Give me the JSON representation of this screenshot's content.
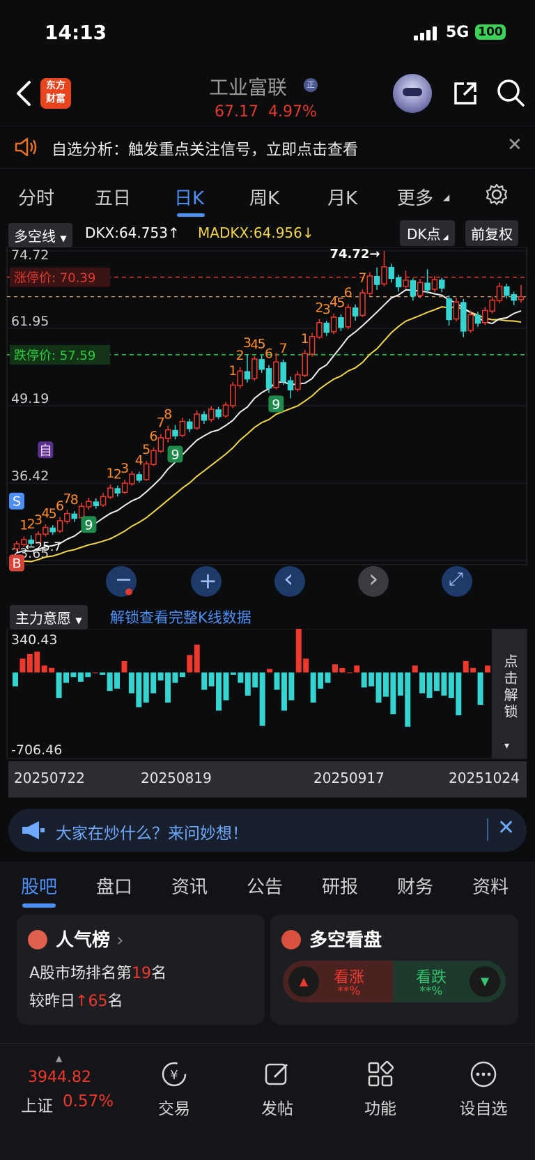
{
  "status_bar": {
    "time": "14:13",
    "network": "5G",
    "battery": "100"
  },
  "nav": {
    "logo_line1": "东方",
    "logo_line2": "财富",
    "stock_name": "工业富联",
    "reg_badge": "正",
    "price": "67.17",
    "change_pct": "4.97%"
  },
  "notice": {
    "text": "自选分析：触发重点关注信号，立即点击查看"
  },
  "chart_tabs": [
    "分时",
    "五日",
    "日K",
    "周K",
    "月K",
    "更多"
  ],
  "chart_header": {
    "indicator": "多空线",
    "dkx": "DKX:64.753",
    "dkx_arrow": "↑",
    "madkx": "MADKX:64.956",
    "madkx_arrow": "↓",
    "dk_button": "DK点",
    "adjust_button": "前复权"
  },
  "chart_data": {
    "type": "candlestick",
    "y_ticks": [
      "74.72",
      "61.95",
      "49.19",
      "36.42",
      "23.65"
    ],
    "limit_up_label": "涨停价: 70.39",
    "limit_down_label": "跌停价: 57.59",
    "limit_up": 70.39,
    "limit_down": 57.59,
    "max_annotation": "74.72",
    "min_annotation": "25.7",
    "ylim": [
      23.65,
      74.72
    ],
    "candles": [
      [
        25.6,
        26.4,
        25.2,
        26.9
      ],
      [
        26.3,
        27.1,
        25.9,
        27.6
      ],
      [
        27.0,
        26.5,
        26.0,
        27.8
      ],
      [
        26.6,
        28.0,
        26.3,
        28.5
      ],
      [
        28.0,
        29.1,
        27.6,
        29.6
      ],
      [
        29.0,
        28.4,
        27.9,
        29.5
      ],
      [
        28.5,
        30.2,
        28.2,
        30.8
      ],
      [
        30.1,
        31.4,
        29.7,
        32.0
      ],
      [
        31.3,
        30.6,
        30.0,
        31.8
      ],
      [
        30.7,
        32.6,
        30.4,
        33.2
      ],
      [
        32.5,
        33.4,
        32.0,
        34.0
      ],
      [
        33.3,
        32.7,
        32.2,
        33.9
      ],
      [
        32.8,
        34.2,
        32.5,
        34.8
      ],
      [
        34.1,
        35.6,
        33.8,
        36.2
      ],
      [
        35.5,
        34.8,
        34.2,
        36.0
      ],
      [
        34.9,
        36.4,
        34.6,
        37.0
      ],
      [
        36.3,
        37.9,
        36.0,
        38.4
      ],
      [
        37.8,
        36.9,
        36.5,
        38.3
      ],
      [
        37.0,
        39.6,
        36.8,
        40.1
      ],
      [
        39.5,
        41.8,
        39.2,
        42.3
      ],
      [
        41.7,
        43.9,
        41.4,
        44.5
      ],
      [
        43.8,
        45.2,
        43.1,
        45.9
      ],
      [
        45.1,
        44.2,
        43.6,
        46.0
      ],
      [
        44.3,
        46.6,
        44.0,
        47.2
      ],
      [
        46.5,
        45.4,
        44.8,
        47.0
      ],
      [
        45.5,
        47.8,
        45.2,
        48.4
      ],
      [
        47.7,
        46.8,
        46.2,
        48.3
      ],
      [
        46.9,
        48.6,
        46.5,
        49.1
      ],
      [
        48.5,
        47.4,
        47.0,
        49.0
      ],
      [
        47.5,
        49.3,
        47.2,
        49.8
      ],
      [
        49.2,
        52.6,
        48.8,
        53.1
      ],
      [
        52.5,
        54.9,
        52.0,
        55.6
      ],
      [
        54.8,
        53.6,
        53.0,
        57.7
      ],
      [
        53.7,
        56.9,
        53.3,
        57.4
      ],
      [
        56.8,
        55.2,
        54.6,
        57.5
      ],
      [
        55.3,
        52.1,
        51.3,
        55.9
      ],
      [
        52.2,
        56.4,
        51.9,
        57.9
      ],
      [
        56.3,
        53.2,
        52.6,
        56.8
      ],
      [
        53.3,
        51.8,
        50.4,
        54.0
      ],
      [
        51.9,
        54.3,
        51.5,
        54.9
      ],
      [
        54.2,
        57.8,
        53.9,
        58.4
      ],
      [
        57.7,
        60.6,
        57.3,
        61.2
      ],
      [
        60.5,
        62.9,
        60.2,
        63.5
      ],
      [
        62.8,
        61.3,
        60.7,
        63.2
      ],
      [
        61.4,
        63.8,
        61.0,
        64.4
      ],
      [
        63.7,
        62.1,
        61.5,
        64.3
      ],
      [
        62.2,
        65.4,
        61.8,
        66.0
      ],
      [
        65.3,
        64.0,
        63.2,
        65.9
      ],
      [
        64.1,
        67.8,
        63.8,
        68.4
      ],
      [
        67.7,
        70.6,
        67.3,
        71.2
      ],
      [
        70.5,
        69.2,
        68.3,
        72.0
      ],
      [
        69.3,
        72.1,
        68.9,
        74.72
      ],
      [
        72.0,
        70.2,
        69.5,
        72.6
      ],
      [
        70.3,
        68.8,
        68.0,
        70.8
      ],
      [
        68.9,
        69.9,
        68.5,
        71.5
      ],
      [
        69.8,
        67.3,
        66.5,
        70.2
      ],
      [
        67.4,
        69.5,
        66.9,
        70.1
      ],
      [
        69.4,
        68.3,
        67.7,
        71.7
      ],
      [
        68.4,
        70.0,
        67.9,
        70.6
      ],
      [
        69.9,
        68.6,
        67.9,
        70.3
      ],
      [
        66.8,
        63.4,
        62.4,
        67.4
      ],
      [
        63.5,
        66.3,
        63.1,
        67.0
      ],
      [
        66.2,
        61.5,
        60.5,
        66.8
      ],
      [
        61.6,
        64.2,
        61.2,
        64.9
      ],
      [
        64.1,
        62.8,
        62.2,
        64.7
      ],
      [
        62.9,
        64.9,
        62.5,
        65.5
      ],
      [
        64.8,
        66.6,
        64.4,
        67.2
      ],
      [
        66.5,
        68.9,
        66.1,
        69.5
      ],
      [
        68.8,
        67.4,
        66.9,
        69.3
      ],
      [
        67.5,
        66.6,
        65.8,
        68.0
      ],
      [
        66.7,
        67.17,
        66.2,
        69.1
      ]
    ],
    "signal_labels": [
      "1",
      "2",
      "3",
      "B",
      "S",
      "4",
      "5",
      "6",
      "7",
      "8",
      "9",
      "自",
      "1",
      "2",
      "3",
      "4",
      "5",
      "6",
      "7",
      "8",
      "9",
      "1",
      "2",
      "3",
      "4",
      "5",
      "6",
      "7",
      "9",
      "1",
      "2",
      "3",
      "4",
      "5",
      "6",
      "7"
    ],
    "indicator_name": "主力意愿",
    "indicator_max": "340.43",
    "indicator_min": "-706.46",
    "indicator_values": [
      -120,
      120,
      160,
      180,
      60,
      40,
      -220,
      -90,
      -40,
      -80,
      -40,
      0,
      -20,
      -160,
      -140,
      100,
      -180,
      -300,
      -260,
      -180,
      -70,
      -260,
      -90,
      -40,
      150,
      240,
      -150,
      -120,
      -330,
      -240,
      -20,
      -90,
      -200,
      -130,
      -460,
      30,
      -150,
      -330,
      -240,
      380,
      120,
      -260,
      -140,
      -90,
      70,
      40,
      0,
      60,
      -130,
      -120,
      -260,
      -210,
      -360,
      -200,
      -470,
      60,
      -180,
      -220,
      -160,
      -200,
      -220,
      -370,
      100,
      40,
      -280,
      60
    ],
    "date_labels": [
      "20250722",
      "20250819",
      "20250917",
      "20251024"
    ]
  },
  "chart_controls": {
    "zoom_out": "−",
    "zoom_in": "+",
    "prev": "‹",
    "next": "›",
    "expand": "⤢"
  },
  "indicator_bar": {
    "indicator": "主力意愿",
    "unlock_text": "解锁查看完整K线数据",
    "side_unlock": "点击解锁"
  },
  "banner": {
    "text": "大家在炒什么？来问妙想！"
  },
  "content_tabs": [
    "股吧",
    "盘口",
    "资讯",
    "公告",
    "研报",
    "财务",
    "资料"
  ],
  "popularity_card": {
    "title": "人气榜",
    "rank_prefix": "A股市场排名第",
    "rank": "19",
    "rank_suffix": "名",
    "change_prefix": "较昨日",
    "change_arrow": "↑",
    "change": "65",
    "change_suffix": "名"
  },
  "sentiment_card": {
    "title": "多空看盘",
    "up_label": "看涨",
    "up_pct": "**%",
    "down_label": "看跌",
    "down_pct": "**%"
  },
  "footer": {
    "index_value": "3944.82",
    "index_name": "上证",
    "index_change": "0.57%",
    "items": [
      "交易",
      "发帖",
      "功能",
      "设自选"
    ]
  },
  "colors": {
    "up": "#f0392d",
    "down": "#35d4d0",
    "accent": "#4d8ff5",
    "dkx": "#ffffff",
    "madkx": "#f3d54b"
  }
}
